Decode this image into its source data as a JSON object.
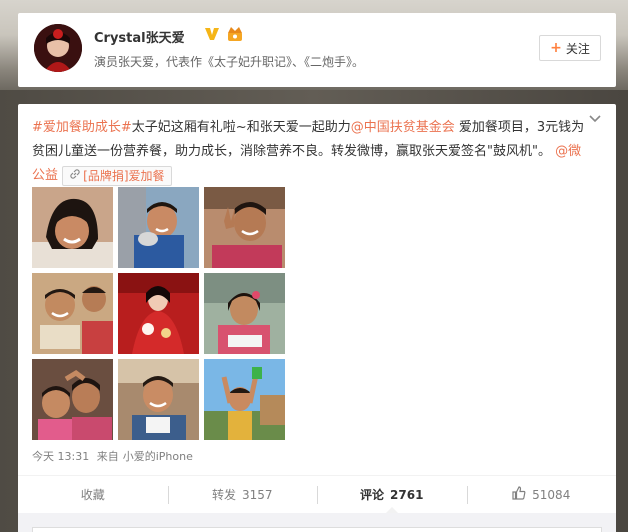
{
  "profile": {
    "name": "Crystal张天爱",
    "bio": "演员张天爱，代表作《太子妃升职记》、《二炮手》。",
    "follow_label": "关注"
  },
  "post": {
    "text_parts": {
      "topic": "#爱加餐助成长#",
      "t1": "太子妃这厢有礼啦~和张天爱一起助力",
      "mention1": "@中国扶贫基金会",
      "t2": " 爱加餐项目，3元钱为贫困儿童送一份营养餐，助力成长，消除营养不良。转发微博，赢取张天爱签名\"鼓风机\"。 ",
      "mention2": "@微公益",
      "chip": "[品牌捐]爱加餐"
    },
    "time": "今天 13:31",
    "from_label": "来自",
    "source": "小爱的iPhone",
    "photos": [
      "photo-1",
      "photo-2",
      "photo-3",
      "photo-4",
      "photo-5",
      "photo-6",
      "photo-7",
      "photo-8",
      "photo-9"
    ]
  },
  "actions": {
    "favorite": "收藏",
    "repost_label": "转发",
    "repost_count": "3157",
    "comment_label": "评论",
    "comment_count": "2761",
    "like_count": "51084"
  },
  "icons": {
    "verified": "verified-v-icon",
    "member": "member-crown-icon",
    "chevron": "chevron-down-icon",
    "link": "link-icon",
    "like": "thumbs-up-icon"
  },
  "colors": {
    "accent": "#eb7350",
    "follow_plus": "#ff8140",
    "verified": "#f5b517",
    "meta": "#808080"
  }
}
